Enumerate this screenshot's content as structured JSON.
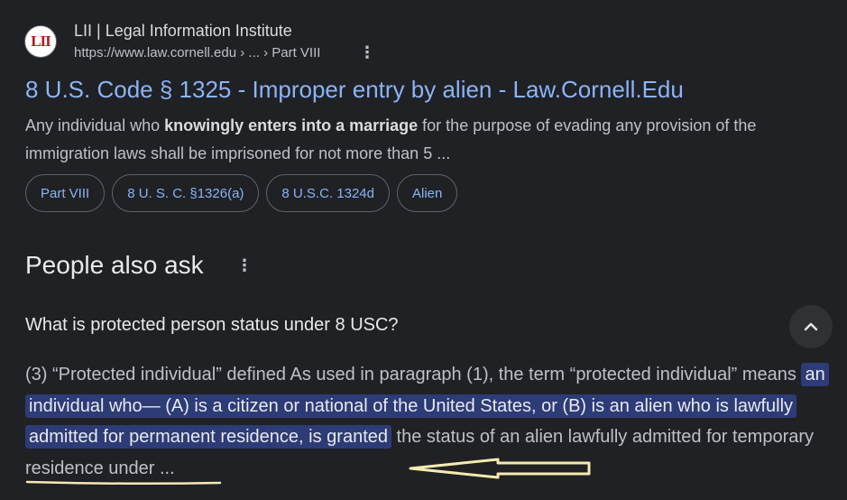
{
  "result": {
    "logo_text": "LII",
    "site_name": "LII | Legal Information Institute",
    "url": "https://www.law.cornell.edu › ... › Part VIII",
    "title": "8 U.S. Code § 1325 - Improper entry by alien - Law.Cornell.Edu",
    "snippet": {
      "before": "Any individual who ",
      "bold": "knowingly enters into a marriage",
      "after": " for the purpose of evading any provision of the immigration laws shall be imprisoned for not more than 5 ..."
    },
    "chips": [
      "Part VIII",
      "8 U. S. C. §1326(a)",
      "8 U.S.C. 1324d",
      "Alien"
    ]
  },
  "people_also_ask": {
    "heading": "People also ask",
    "question": "What is protected person status under 8 USC?",
    "answer": {
      "before": "(3) “Protected individual” defined As used in paragraph (1), the term “protected individual” means ",
      "highlight": "an individual who— (A) is a citizen or national of the United States, or (B) is an alien who is lawfully admitted for permanent residence, is granted",
      "after": " the status of an alien lawfully admitted for temporary residence under ..."
    }
  },
  "colors": {
    "background": "#202124",
    "link": "#8ab4f8",
    "highlight": "#2d3b76",
    "annotation": "#f5eab0"
  },
  "icons": [
    "kebab-menu-icon",
    "chevron-up-icon",
    "left-arrow-annotation"
  ]
}
